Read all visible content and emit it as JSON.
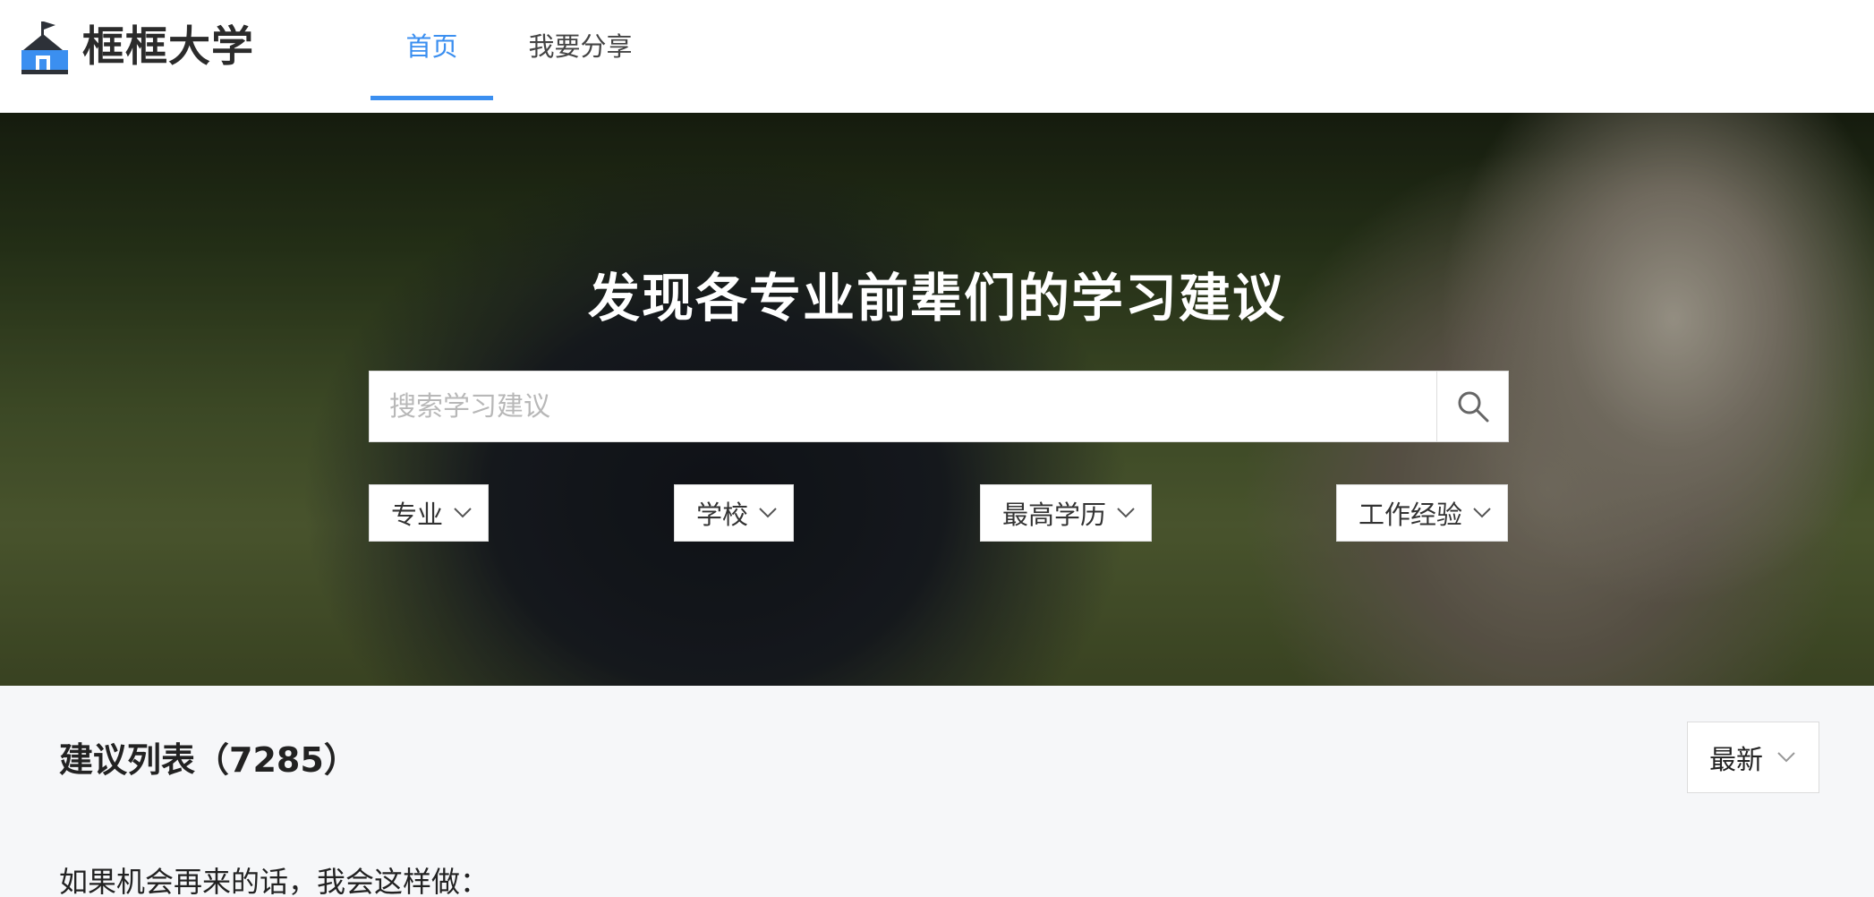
{
  "header": {
    "logo_text": "框框大学",
    "logo_icon": "school-house-icon",
    "tabs": [
      {
        "label": "首页",
        "active": true
      },
      {
        "label": "我要分享",
        "active": false
      }
    ]
  },
  "hero": {
    "title": "发现各专业前辈们的学习建议",
    "search": {
      "placeholder": "搜索学习建议",
      "value": ""
    },
    "filters": [
      {
        "label": "专业"
      },
      {
        "label": "学校"
      },
      {
        "label": "最高学历"
      },
      {
        "label": "工作经验"
      }
    ]
  },
  "content": {
    "list_title": "建议列表（7285）",
    "sort_label": "最新",
    "first_item_title": "如果机会再来的话，我会这样做："
  },
  "colors": {
    "accent": "#3b8ff0",
    "text": "#222222",
    "background": "#f6f7f9"
  }
}
